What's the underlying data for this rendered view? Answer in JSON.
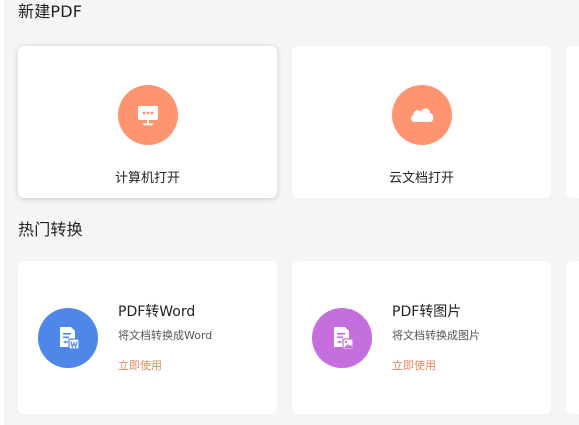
{
  "sections": {
    "new_pdf": {
      "title": "新建PDF",
      "cards": [
        {
          "label": "计算机打开",
          "icon": "computer-icon"
        },
        {
          "label": "云文档打开",
          "icon": "cloud-icon"
        }
      ]
    },
    "hot_conversions": {
      "title": "热门转换",
      "tools": [
        {
          "title": "PDF转Word",
          "desc": "将文档转换成Word",
          "action": "立即使用",
          "icon": "pdf-to-word-icon"
        },
        {
          "title": "PDF转图片",
          "desc": "将文档转换成图片",
          "action": "立即使用",
          "icon": "pdf-to-image-icon"
        }
      ]
    }
  },
  "colors": {
    "orange_circle": "#fe9570",
    "word_blue": "#4f87e9",
    "image_purple": "#c56fdf",
    "action_orange": "#f0855e"
  }
}
